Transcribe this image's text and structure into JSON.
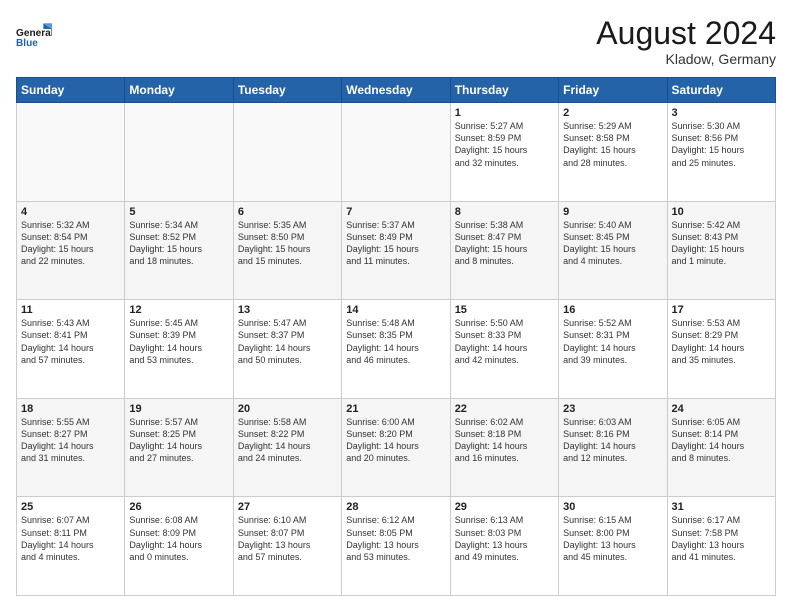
{
  "header": {
    "title": "August 2024",
    "location": "Kladow, Germany",
    "logo_line1": "General",
    "logo_line2": "Blue"
  },
  "calendar": {
    "headers": [
      "Sunday",
      "Monday",
      "Tuesday",
      "Wednesday",
      "Thursday",
      "Friday",
      "Saturday"
    ],
    "rows": [
      [
        {
          "day": "",
          "info": ""
        },
        {
          "day": "",
          "info": ""
        },
        {
          "day": "",
          "info": ""
        },
        {
          "day": "",
          "info": ""
        },
        {
          "day": "1",
          "info": "Sunrise: 5:27 AM\nSunset: 8:59 PM\nDaylight: 15 hours\nand 32 minutes."
        },
        {
          "day": "2",
          "info": "Sunrise: 5:29 AM\nSunset: 8:58 PM\nDaylight: 15 hours\nand 28 minutes."
        },
        {
          "day": "3",
          "info": "Sunrise: 5:30 AM\nSunset: 8:56 PM\nDaylight: 15 hours\nand 25 minutes."
        }
      ],
      [
        {
          "day": "4",
          "info": "Sunrise: 5:32 AM\nSunset: 8:54 PM\nDaylight: 15 hours\nand 22 minutes."
        },
        {
          "day": "5",
          "info": "Sunrise: 5:34 AM\nSunset: 8:52 PM\nDaylight: 15 hours\nand 18 minutes."
        },
        {
          "day": "6",
          "info": "Sunrise: 5:35 AM\nSunset: 8:50 PM\nDaylight: 15 hours\nand 15 minutes."
        },
        {
          "day": "7",
          "info": "Sunrise: 5:37 AM\nSunset: 8:49 PM\nDaylight: 15 hours\nand 11 minutes."
        },
        {
          "day": "8",
          "info": "Sunrise: 5:38 AM\nSunset: 8:47 PM\nDaylight: 15 hours\nand 8 minutes."
        },
        {
          "day": "9",
          "info": "Sunrise: 5:40 AM\nSunset: 8:45 PM\nDaylight: 15 hours\nand 4 minutes."
        },
        {
          "day": "10",
          "info": "Sunrise: 5:42 AM\nSunset: 8:43 PM\nDaylight: 15 hours\nand 1 minute."
        }
      ],
      [
        {
          "day": "11",
          "info": "Sunrise: 5:43 AM\nSunset: 8:41 PM\nDaylight: 14 hours\nand 57 minutes."
        },
        {
          "day": "12",
          "info": "Sunrise: 5:45 AM\nSunset: 8:39 PM\nDaylight: 14 hours\nand 53 minutes."
        },
        {
          "day": "13",
          "info": "Sunrise: 5:47 AM\nSunset: 8:37 PM\nDaylight: 14 hours\nand 50 minutes."
        },
        {
          "day": "14",
          "info": "Sunrise: 5:48 AM\nSunset: 8:35 PM\nDaylight: 14 hours\nand 46 minutes."
        },
        {
          "day": "15",
          "info": "Sunrise: 5:50 AM\nSunset: 8:33 PM\nDaylight: 14 hours\nand 42 minutes."
        },
        {
          "day": "16",
          "info": "Sunrise: 5:52 AM\nSunset: 8:31 PM\nDaylight: 14 hours\nand 39 minutes."
        },
        {
          "day": "17",
          "info": "Sunrise: 5:53 AM\nSunset: 8:29 PM\nDaylight: 14 hours\nand 35 minutes."
        }
      ],
      [
        {
          "day": "18",
          "info": "Sunrise: 5:55 AM\nSunset: 8:27 PM\nDaylight: 14 hours\nand 31 minutes."
        },
        {
          "day": "19",
          "info": "Sunrise: 5:57 AM\nSunset: 8:25 PM\nDaylight: 14 hours\nand 27 minutes."
        },
        {
          "day": "20",
          "info": "Sunrise: 5:58 AM\nSunset: 8:22 PM\nDaylight: 14 hours\nand 24 minutes."
        },
        {
          "day": "21",
          "info": "Sunrise: 6:00 AM\nSunset: 8:20 PM\nDaylight: 14 hours\nand 20 minutes."
        },
        {
          "day": "22",
          "info": "Sunrise: 6:02 AM\nSunset: 8:18 PM\nDaylight: 14 hours\nand 16 minutes."
        },
        {
          "day": "23",
          "info": "Sunrise: 6:03 AM\nSunset: 8:16 PM\nDaylight: 14 hours\nand 12 minutes."
        },
        {
          "day": "24",
          "info": "Sunrise: 6:05 AM\nSunset: 8:14 PM\nDaylight: 14 hours\nand 8 minutes."
        }
      ],
      [
        {
          "day": "25",
          "info": "Sunrise: 6:07 AM\nSunset: 8:11 PM\nDaylight: 14 hours\nand 4 minutes."
        },
        {
          "day": "26",
          "info": "Sunrise: 6:08 AM\nSunset: 8:09 PM\nDaylight: 14 hours\nand 0 minutes."
        },
        {
          "day": "27",
          "info": "Sunrise: 6:10 AM\nSunset: 8:07 PM\nDaylight: 13 hours\nand 57 minutes."
        },
        {
          "day": "28",
          "info": "Sunrise: 6:12 AM\nSunset: 8:05 PM\nDaylight: 13 hours\nand 53 minutes."
        },
        {
          "day": "29",
          "info": "Sunrise: 6:13 AM\nSunset: 8:03 PM\nDaylight: 13 hours\nand 49 minutes."
        },
        {
          "day": "30",
          "info": "Sunrise: 6:15 AM\nSunset: 8:00 PM\nDaylight: 13 hours\nand 45 minutes."
        },
        {
          "day": "31",
          "info": "Sunrise: 6:17 AM\nSunset: 7:58 PM\nDaylight: 13 hours\nand 41 minutes."
        }
      ]
    ]
  }
}
